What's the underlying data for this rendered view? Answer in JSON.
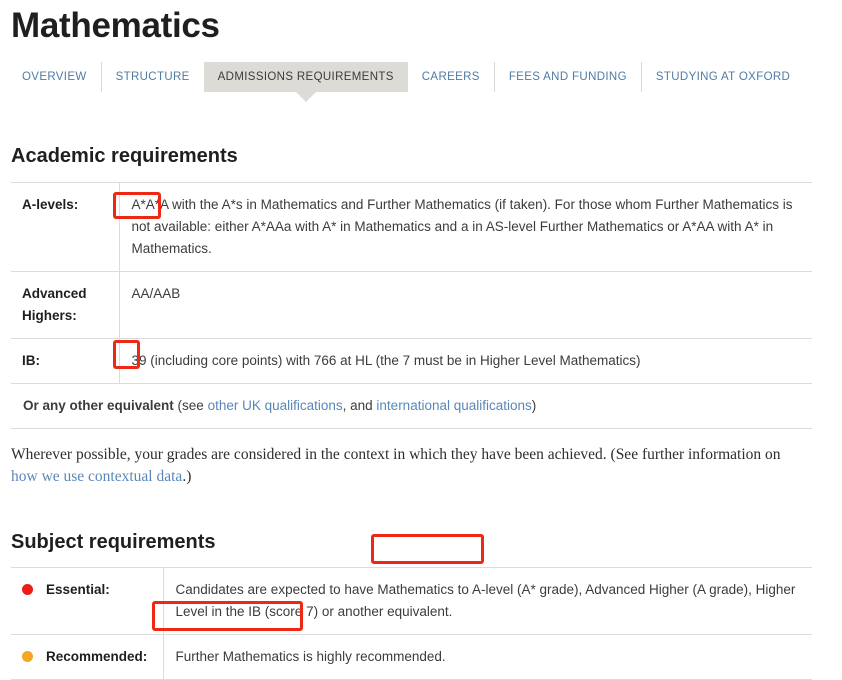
{
  "header": {
    "title": "Mathematics"
  },
  "tabs": [
    {
      "label": "OVERVIEW",
      "active": false
    },
    {
      "label": "STRUCTURE",
      "active": false
    },
    {
      "label": "ADMISSIONS REQUIREMENTS",
      "active": true
    },
    {
      "label": "CAREERS",
      "active": false
    },
    {
      "label": "FEES AND FUNDING",
      "active": false
    },
    {
      "label": "STUDYING AT OXFORD",
      "active": false
    }
  ],
  "academic": {
    "heading": "Academic requirements",
    "rows": {
      "alevels": {
        "label": "A-levels:",
        "grade": "A*A*A",
        "text": " with the A*s in Mathematics and Further Mathematics (if taken). For those whom Further Mathematics is not available: either A*AAa with A* in Mathematics and a in AS-level Further Mathematics or A*AA with A* in Mathematics."
      },
      "advanced_highers": {
        "label": "Advanced Highers:",
        "value": "AA/AAB"
      },
      "ib": {
        "label": "IB:",
        "score": "39",
        "text": " (including core points) with 766 at HL (the 7 must be in Higher Level Mathematics)"
      },
      "equivalent": {
        "lead": "Or any other equivalent",
        "see": " (see ",
        "link1": "other UK qualifications",
        "mid": ", and ",
        "link2": "international qualifications",
        "tail": ")"
      }
    }
  },
  "context_note": {
    "text_before": "Wherever possible, your grades are considered in the context in which they have been achieved.  (See further information on ",
    "link": "how we use contextual data",
    "text_after": ".)"
  },
  "subject": {
    "heading": "Subject requirements",
    "rows": [
      {
        "label": "Essential:",
        "dot_color": "#ee1c13",
        "highlight": "Mathematics to",
        "text_before": "Candidates are expected to have ",
        "text_after": " A-level (A* grade), Advanced Higher (A grade), Higher Level in the IB (score 7) or another equivalent."
      },
      {
        "label": "Recommended:",
        "dot_color": "#f5a623",
        "highlight": "Further Mathematics",
        "text_before": "",
        "text_after": " is highly recommended."
      }
    ]
  },
  "annotations": {
    "box_color": "#ef2816",
    "boxes": [
      {
        "name": "alevels-grade-highlight",
        "target": "A*A*A"
      },
      {
        "name": "ib-score-highlight",
        "target": "39"
      },
      {
        "name": "essential-subject-highlight",
        "target": "Mathematics to"
      },
      {
        "name": "recommended-subject-highlight",
        "target": "Further Mathematics"
      }
    ]
  }
}
